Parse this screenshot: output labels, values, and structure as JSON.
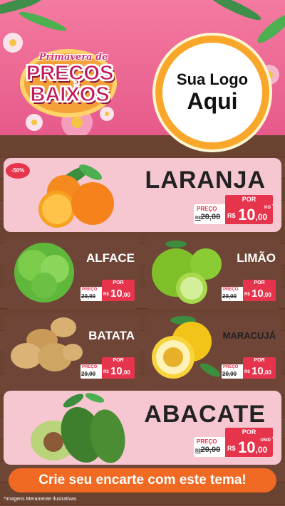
{
  "header": {
    "badge_script": "Primavera de",
    "badge_line1": "PREÇOS",
    "badge_line2": "BAIXOS",
    "logo_line1": "Sua Logo",
    "logo_line2": "Aqui"
  },
  "discount_badge": "-50%",
  "price_labels": {
    "por": "POR",
    "preco": "PREÇO",
    "currency": "R$"
  },
  "products": {
    "laranja": {
      "name": "LARANJA",
      "old_price_prefix": "R$",
      "old_price": "20,00",
      "price_int": "10",
      "price_cents": ",00",
      "unit": "KG"
    },
    "alface": {
      "name": "ALFACE",
      "old_price": "20,00",
      "price_int": "10",
      "price_cents": ",00"
    },
    "limao": {
      "name": "LIMÃO",
      "old_price": "20,00",
      "price_int": "10",
      "price_cents": ",00"
    },
    "batata": {
      "name": "BATATA",
      "old_price": "20,00",
      "price_int": "10",
      "price_cents": ",00"
    },
    "maracuja": {
      "name": "MARACUJÁ",
      "old_price": "20,00",
      "price_int": "10",
      "price_cents": ",00"
    },
    "abacate": {
      "name": "ABACATE",
      "old_price_prefix": "R$",
      "old_price": "20,00",
      "price_int": "10",
      "price_cents": ",00",
      "unit": "UNID"
    }
  },
  "cta": "Crie seu encarte com este tema!",
  "disclaimer": "*Imagens Meramente Ilustrativas",
  "colors": {
    "header_pink": "#e65a8a",
    "card_pink": "#f6c7d1",
    "price_red": "#e7344d",
    "cta_orange": "#f06a24",
    "logo_ring": "#f8a72a"
  }
}
